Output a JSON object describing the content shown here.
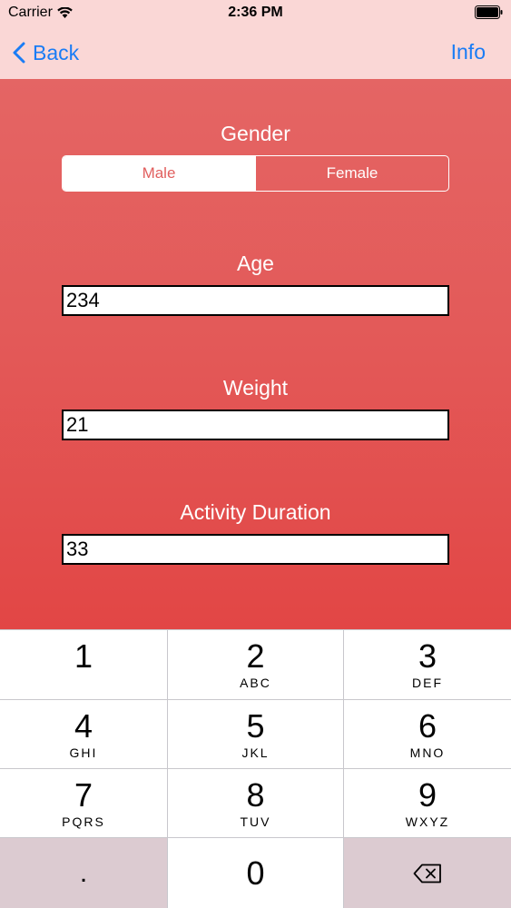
{
  "status_bar": {
    "carrier": "Carrier",
    "time": "2:36 PM"
  },
  "nav": {
    "back_label": "Back",
    "info_label": "Info"
  },
  "form": {
    "gender_label": "Gender",
    "gender_options": [
      "Male",
      "Female"
    ],
    "gender_selected": "Male",
    "age_label": "Age",
    "age_value": "234",
    "weight_label": "Weight",
    "weight_value": "21",
    "duration_label": "Activity Duration",
    "duration_value": "33"
  },
  "keyboard": {
    "keys": [
      {
        "digit": "1",
        "letters": ""
      },
      {
        "digit": "2",
        "letters": "ABC"
      },
      {
        "digit": "3",
        "letters": "DEF"
      },
      {
        "digit": "4",
        "letters": "GHI"
      },
      {
        "digit": "5",
        "letters": "JKL"
      },
      {
        "digit": "6",
        "letters": "MNO"
      },
      {
        "digit": "7",
        "letters": "PQRS"
      },
      {
        "digit": "8",
        "letters": "TUV"
      },
      {
        "digit": "9",
        "letters": "WXYZ"
      }
    ],
    "decimal": ".",
    "zero": "0"
  },
  "colors": {
    "nav_background": "#fad7d6",
    "accent_blue": "#1a7cf5",
    "form_background_top": "#e46564",
    "form_background_bottom": "#e24645"
  }
}
